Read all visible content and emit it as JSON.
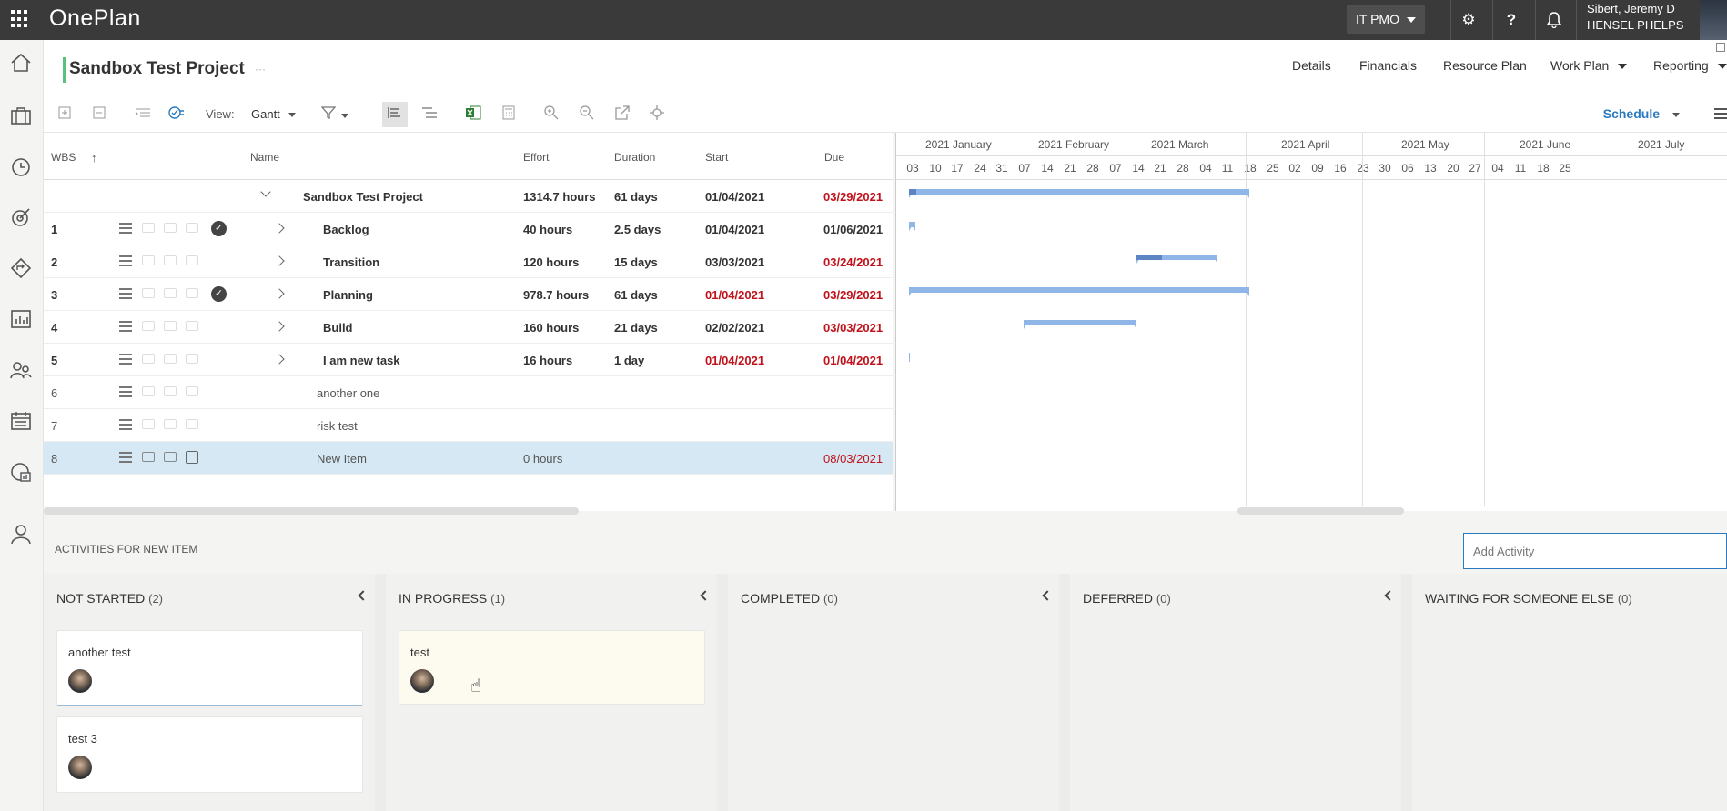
{
  "app": {
    "brand": "OnePlan",
    "portfolio": "IT PMO",
    "user_name": "Sibert, Jeremy D",
    "user_org": "HENSEL PHELPS"
  },
  "header": {
    "title": "Sandbox Test Project",
    "dots": "···"
  },
  "tabs": [
    "Details",
    "Financials",
    "Resource Plan",
    "Work Plan",
    "Reporting"
  ],
  "toolbar": {
    "view_label": "View:",
    "view_value": "Gantt",
    "schedule": "Schedule"
  },
  "grid": {
    "columns": {
      "wbs": "WBS",
      "name": "Name",
      "effort": "Effort",
      "duration": "Duration",
      "start": "Start",
      "due": "Due"
    },
    "rows": [
      {
        "wbs": "",
        "name": "Sandbox Test Project",
        "effort": "1314.7 hours",
        "duration": "61 days",
        "start": "01/04/2021",
        "due": "03/29/2021"
      },
      {
        "wbs": "1",
        "name": "Backlog",
        "effort": "40 hours",
        "duration": "2.5 days",
        "start": "01/04/2021",
        "due": "01/06/2021"
      },
      {
        "wbs": "2",
        "name": "Transition",
        "effort": "120 hours",
        "duration": "15 days",
        "start": "03/03/2021",
        "due": "03/24/2021"
      },
      {
        "wbs": "3",
        "name": "Planning",
        "effort": "978.7 hours",
        "duration": "61 days",
        "start": "01/04/2021",
        "due": "03/29/2021"
      },
      {
        "wbs": "4",
        "name": "Build",
        "effort": "160 hours",
        "duration": "21 days",
        "start": "02/02/2021",
        "due": "03/03/2021"
      },
      {
        "wbs": "5",
        "name": "I am new task",
        "effort": "16 hours",
        "duration": "1 day",
        "start": "01/04/2021",
        "due": "01/04/2021"
      },
      {
        "wbs": "6",
        "name": "another one",
        "effort": "",
        "duration": "",
        "start": "",
        "due": ""
      },
      {
        "wbs": "7",
        "name": "risk test",
        "effort": "",
        "duration": "",
        "start": "",
        "due": ""
      },
      {
        "wbs": "8",
        "name": "New Item",
        "effort": "0 hours",
        "duration": "",
        "start": "",
        "due": "08/03/2021"
      }
    ]
  },
  "gantt": {
    "months": [
      "2021 January",
      "2021 February",
      "2021 March",
      "2021 April",
      "2021 May",
      "2021 June",
      "2021 July"
    ],
    "weeks": [
      "03",
      "10",
      "17",
      "24",
      "31",
      "07",
      "14",
      "21",
      "28",
      "07",
      "14",
      "21",
      "28",
      "04",
      "11",
      "18",
      "25",
      "02",
      "09",
      "16",
      "23",
      "30",
      "06",
      "13",
      "20",
      "27",
      "04",
      "11",
      "18",
      "25"
    ]
  },
  "activities": {
    "label": "ACTIVITIES FOR NEW ITEM",
    "add_placeholder": "Add Activity",
    "columns": [
      {
        "title": "NOT STARTED",
        "count": "(2)",
        "cards": [
          "another test",
          "test 3"
        ]
      },
      {
        "title": "IN PROGRESS",
        "count": "(1)",
        "cards": [
          "test"
        ]
      },
      {
        "title": "COMPLETED",
        "count": "(0)",
        "cards": []
      },
      {
        "title": "DEFERRED",
        "count": "(0)",
        "cards": []
      },
      {
        "title": "WAITING FOR SOMEONE ELSE",
        "count": "(0)",
        "cards": []
      }
    ]
  }
}
